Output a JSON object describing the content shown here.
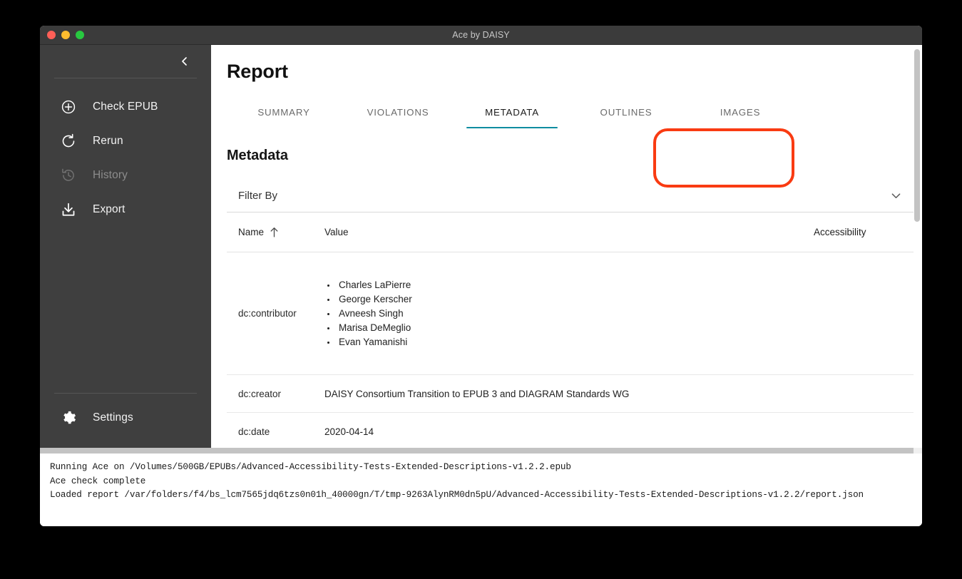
{
  "window": {
    "title": "Ace by DAISY",
    "traffic_lights": [
      "close-red",
      "minimize-yellow",
      "maximize-green"
    ]
  },
  "sidebar": {
    "collapse_icon": "chevron-left-icon",
    "items": [
      {
        "label": "Check EPUB",
        "icon": "plus-circle-icon",
        "state": "enabled"
      },
      {
        "label": "Rerun",
        "icon": "refresh-icon",
        "state": "enabled"
      },
      {
        "label": "History",
        "icon": "history-clock-icon",
        "state": "disabled"
      },
      {
        "label": "Export",
        "icon": "download-icon",
        "state": "enabled"
      }
    ],
    "bottom": {
      "label": "Settings",
      "icon": "gear-icon"
    }
  },
  "main": {
    "page_title": "Report",
    "tabs": [
      {
        "label": "SUMMARY",
        "active": false
      },
      {
        "label": "VIOLATIONS",
        "active": false
      },
      {
        "label": "METADATA",
        "active": true
      },
      {
        "label": "OUTLINES",
        "active": false
      },
      {
        "label": "IMAGES",
        "active": false
      }
    ],
    "active_tab_underline_color": "#0e8ca0",
    "annotation_color": "#f93b12",
    "section_title": "Metadata",
    "filter": {
      "label": "Filter By",
      "icon": "chevron-down-icon"
    },
    "table": {
      "columns": [
        "Name",
        "Value",
        "Accessibility"
      ],
      "sort": {
        "column": "Name",
        "direction": "ascending",
        "icon": "arrow-up-icon"
      },
      "rows": [
        {
          "name": "dc:contributor",
          "values": [
            "Charles LaPierre",
            "George Kerscher",
            "Avneesh Singh",
            "Marisa DeMeglio",
            "Evan Yamanishi"
          ],
          "accessibility": ""
        },
        {
          "name": "dc:creator",
          "value": "DAISY Consortium Transition to EPUB 3 and DIAGRAM Standards WG",
          "accessibility": ""
        },
        {
          "name": "dc:date",
          "value": "2020-04-14",
          "accessibility": ""
        }
      ]
    }
  },
  "console": {
    "lines": [
      "Running Ace on /Volumes/500GB/EPUBs/Advanced-Accessibility-Tests-Extended-Descriptions-v1.2.2.epub",
      "Ace check complete",
      "Loaded report /var/folders/f4/bs_lcm7565jdq6tzs0n01h_40000gn/T/tmp-9263AlynRM0dn5pU/Advanced-Accessibility-Tests-Extended-Descriptions-v1.2.2/report.json"
    ]
  }
}
